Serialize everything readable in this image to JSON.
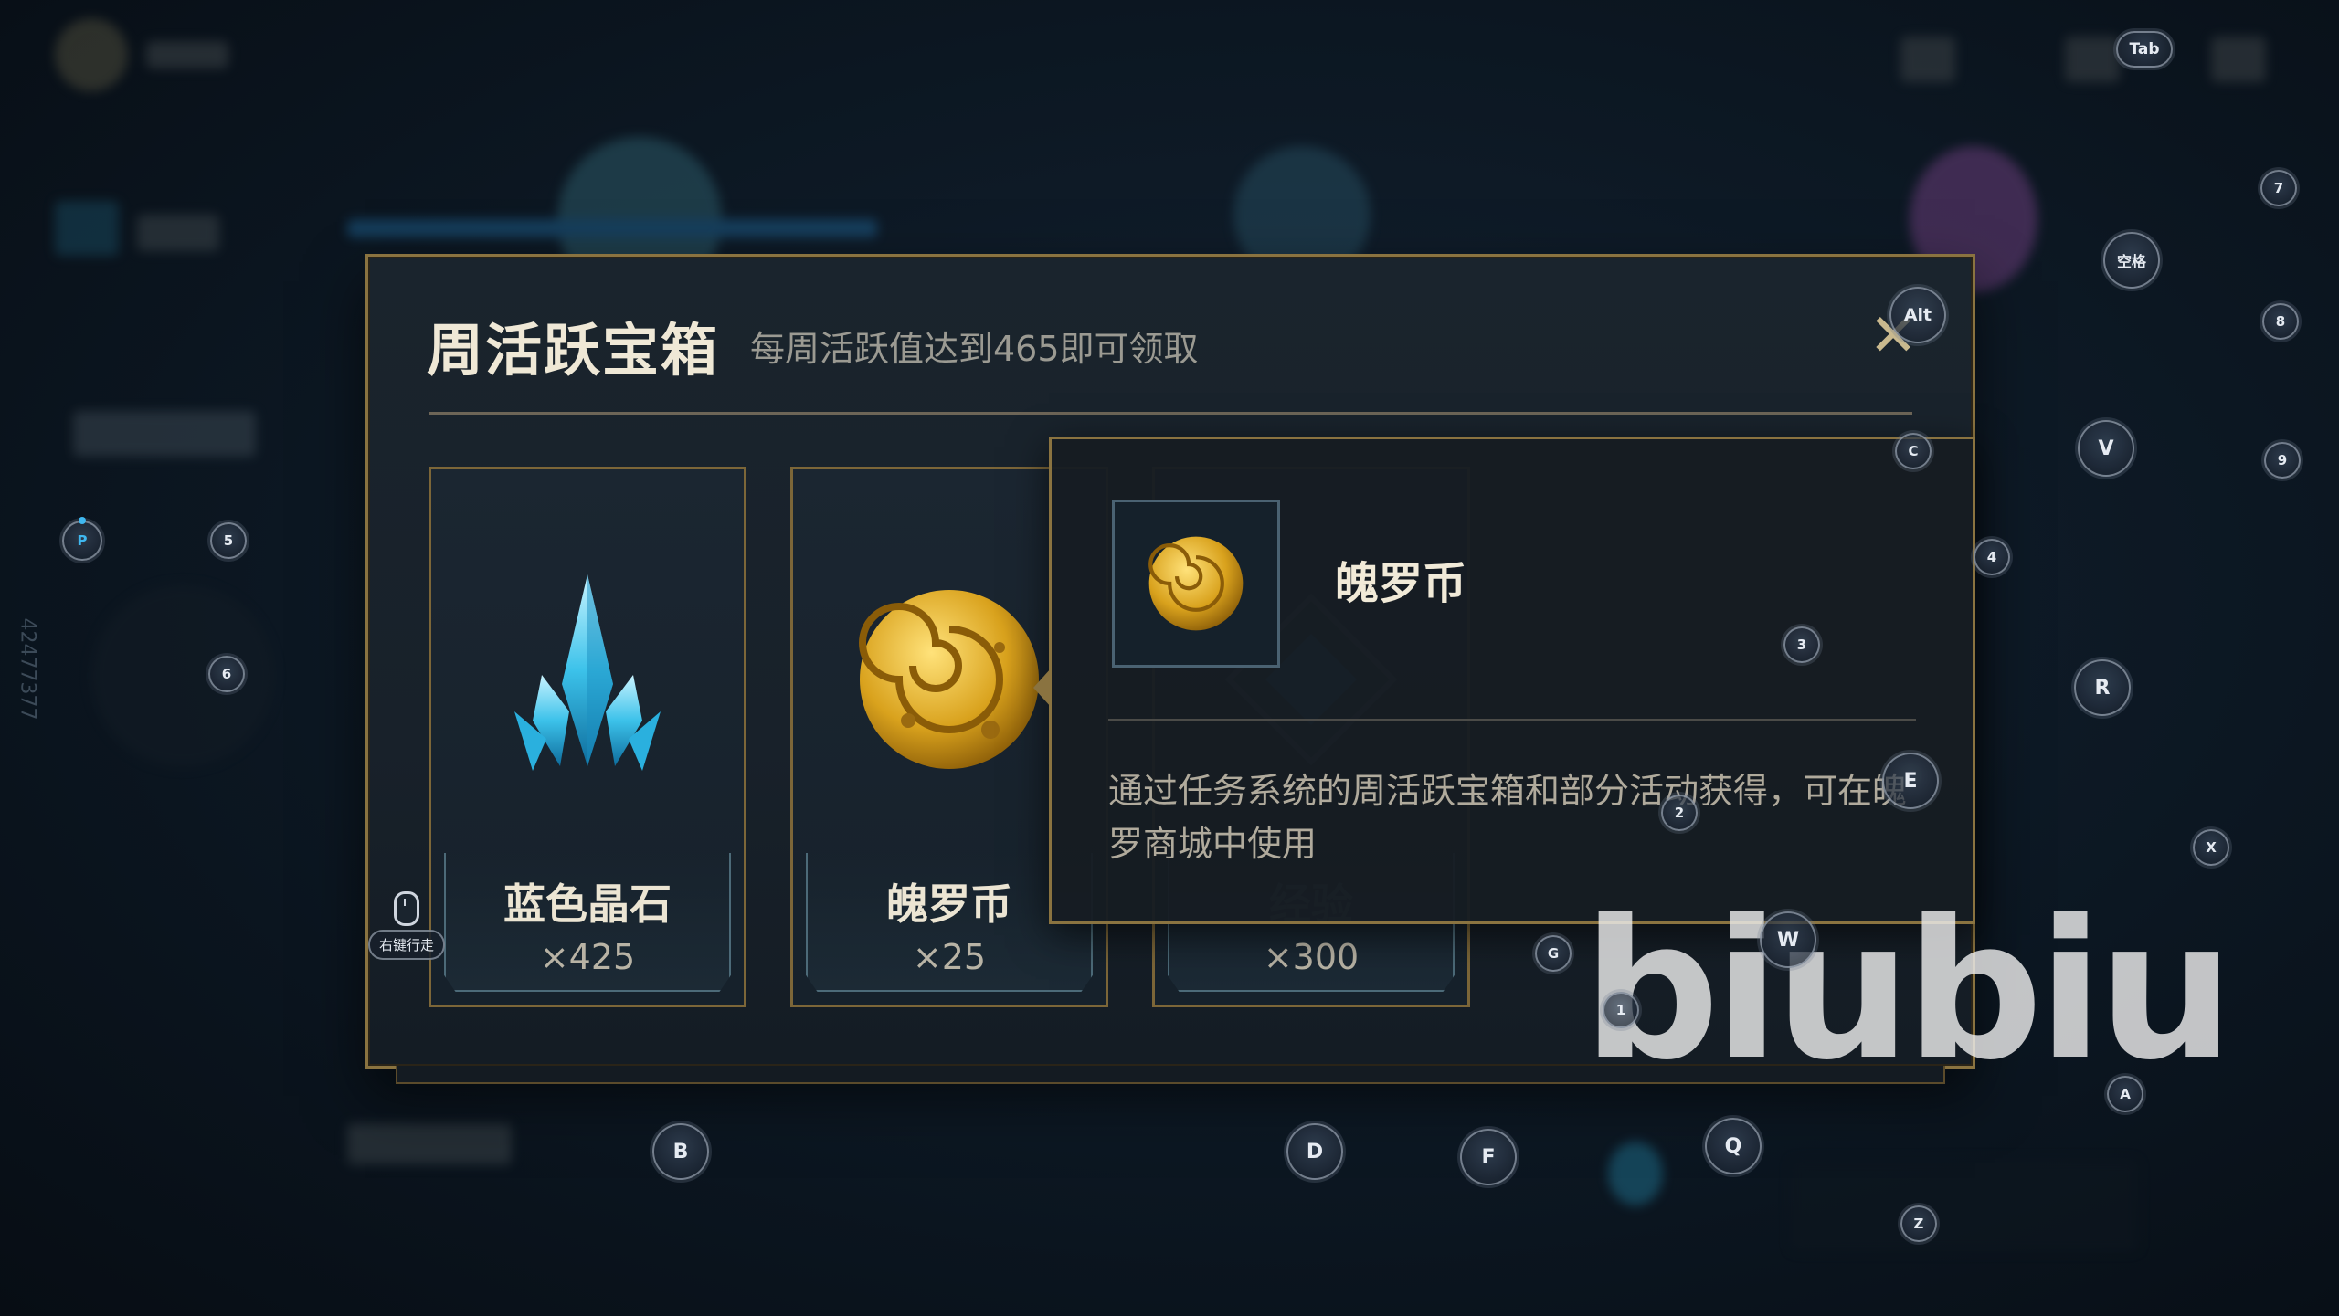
{
  "dialog": {
    "title": "周活跃宝箱",
    "subtitle": "每周活跃值达到465即可领取",
    "close_label": "✕"
  },
  "rewards": [
    {
      "name": "蓝色晶石",
      "qty": "×425",
      "icon": "blue-crystal-icon"
    },
    {
      "name": "魄罗币",
      "qty": "×25",
      "icon": "poro-coin-icon"
    },
    {
      "name": "经验",
      "qty": "×300",
      "icon": "experience-icon"
    }
  ],
  "tooltip": {
    "name": "魄罗币",
    "description": "通过任务系统的周活跃宝箱和部分活动获得，可在魄罗商城中使用"
  },
  "mouse_hint": {
    "label": "右键行走"
  },
  "watermark": "biubiu",
  "side_id": "42477377",
  "hotkeys": {
    "tab": "Tab",
    "seven": "7",
    "space": "空格",
    "eight": "8",
    "alt": "Alt",
    "v": "V",
    "nine": "9",
    "c": "C",
    "four": "4",
    "p": "P",
    "five": "5",
    "six": "6",
    "three": "3",
    "r": "R",
    "e": "E",
    "two": "2",
    "x": "X",
    "w": "W",
    "g": "G",
    "one": "1",
    "a": "A",
    "b": "B",
    "d": "D",
    "f": "F",
    "q": "Q",
    "z": "Z"
  },
  "colors": {
    "gold_border": "#8a7340",
    "panel_bg": "#18212a",
    "title_text": "#efe8d6",
    "active_key": "#3fb8f0"
  }
}
